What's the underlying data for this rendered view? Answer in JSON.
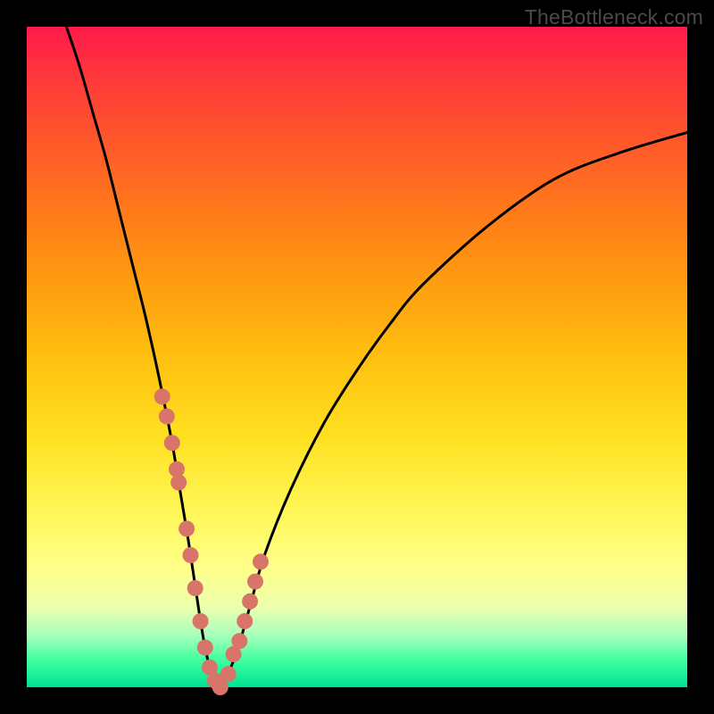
{
  "watermark": "TheBottleneck.com",
  "chart_data": {
    "type": "line",
    "title": "",
    "xlabel": "",
    "ylabel": "",
    "xlim": [
      0,
      100
    ],
    "ylim": [
      0,
      100
    ],
    "grid": false,
    "legend": false,
    "background": "rainbow-vertical-gradient red-top green-bottom",
    "series": [
      {
        "name": "bottleneck-curve",
        "x": [
          6,
          8,
          10,
          12,
          14,
          16,
          18,
          20,
          22,
          23,
          24.5,
          26,
          27,
          28,
          29,
          30,
          32,
          34,
          36,
          40,
          45,
          50,
          55,
          60,
          70,
          80,
          90,
          100
        ],
        "y": [
          100,
          94,
          87,
          80,
          72,
          64,
          56,
          47,
          37,
          31,
          22,
          12,
          6,
          2,
          0,
          1,
          6,
          13,
          20,
          30,
          40,
          48,
          55,
          61,
          70,
          77,
          81,
          84
        ]
      }
    ],
    "markers": [
      {
        "name": "highlight-dots",
        "x": [
          20.5,
          21.2,
          22.0,
          22.7,
          23.0,
          24.2,
          24.8,
          25.5,
          26.3,
          27.0,
          27.7,
          28.5,
          29.3,
          30.5,
          31.3,
          32.2,
          33.0,
          33.8,
          34.6,
          35.4
        ],
        "y": [
          44,
          41,
          37,
          33,
          31,
          24,
          20,
          15,
          10,
          6,
          3,
          1,
          0,
          2,
          5,
          7,
          10,
          13,
          16,
          19
        ]
      }
    ]
  }
}
